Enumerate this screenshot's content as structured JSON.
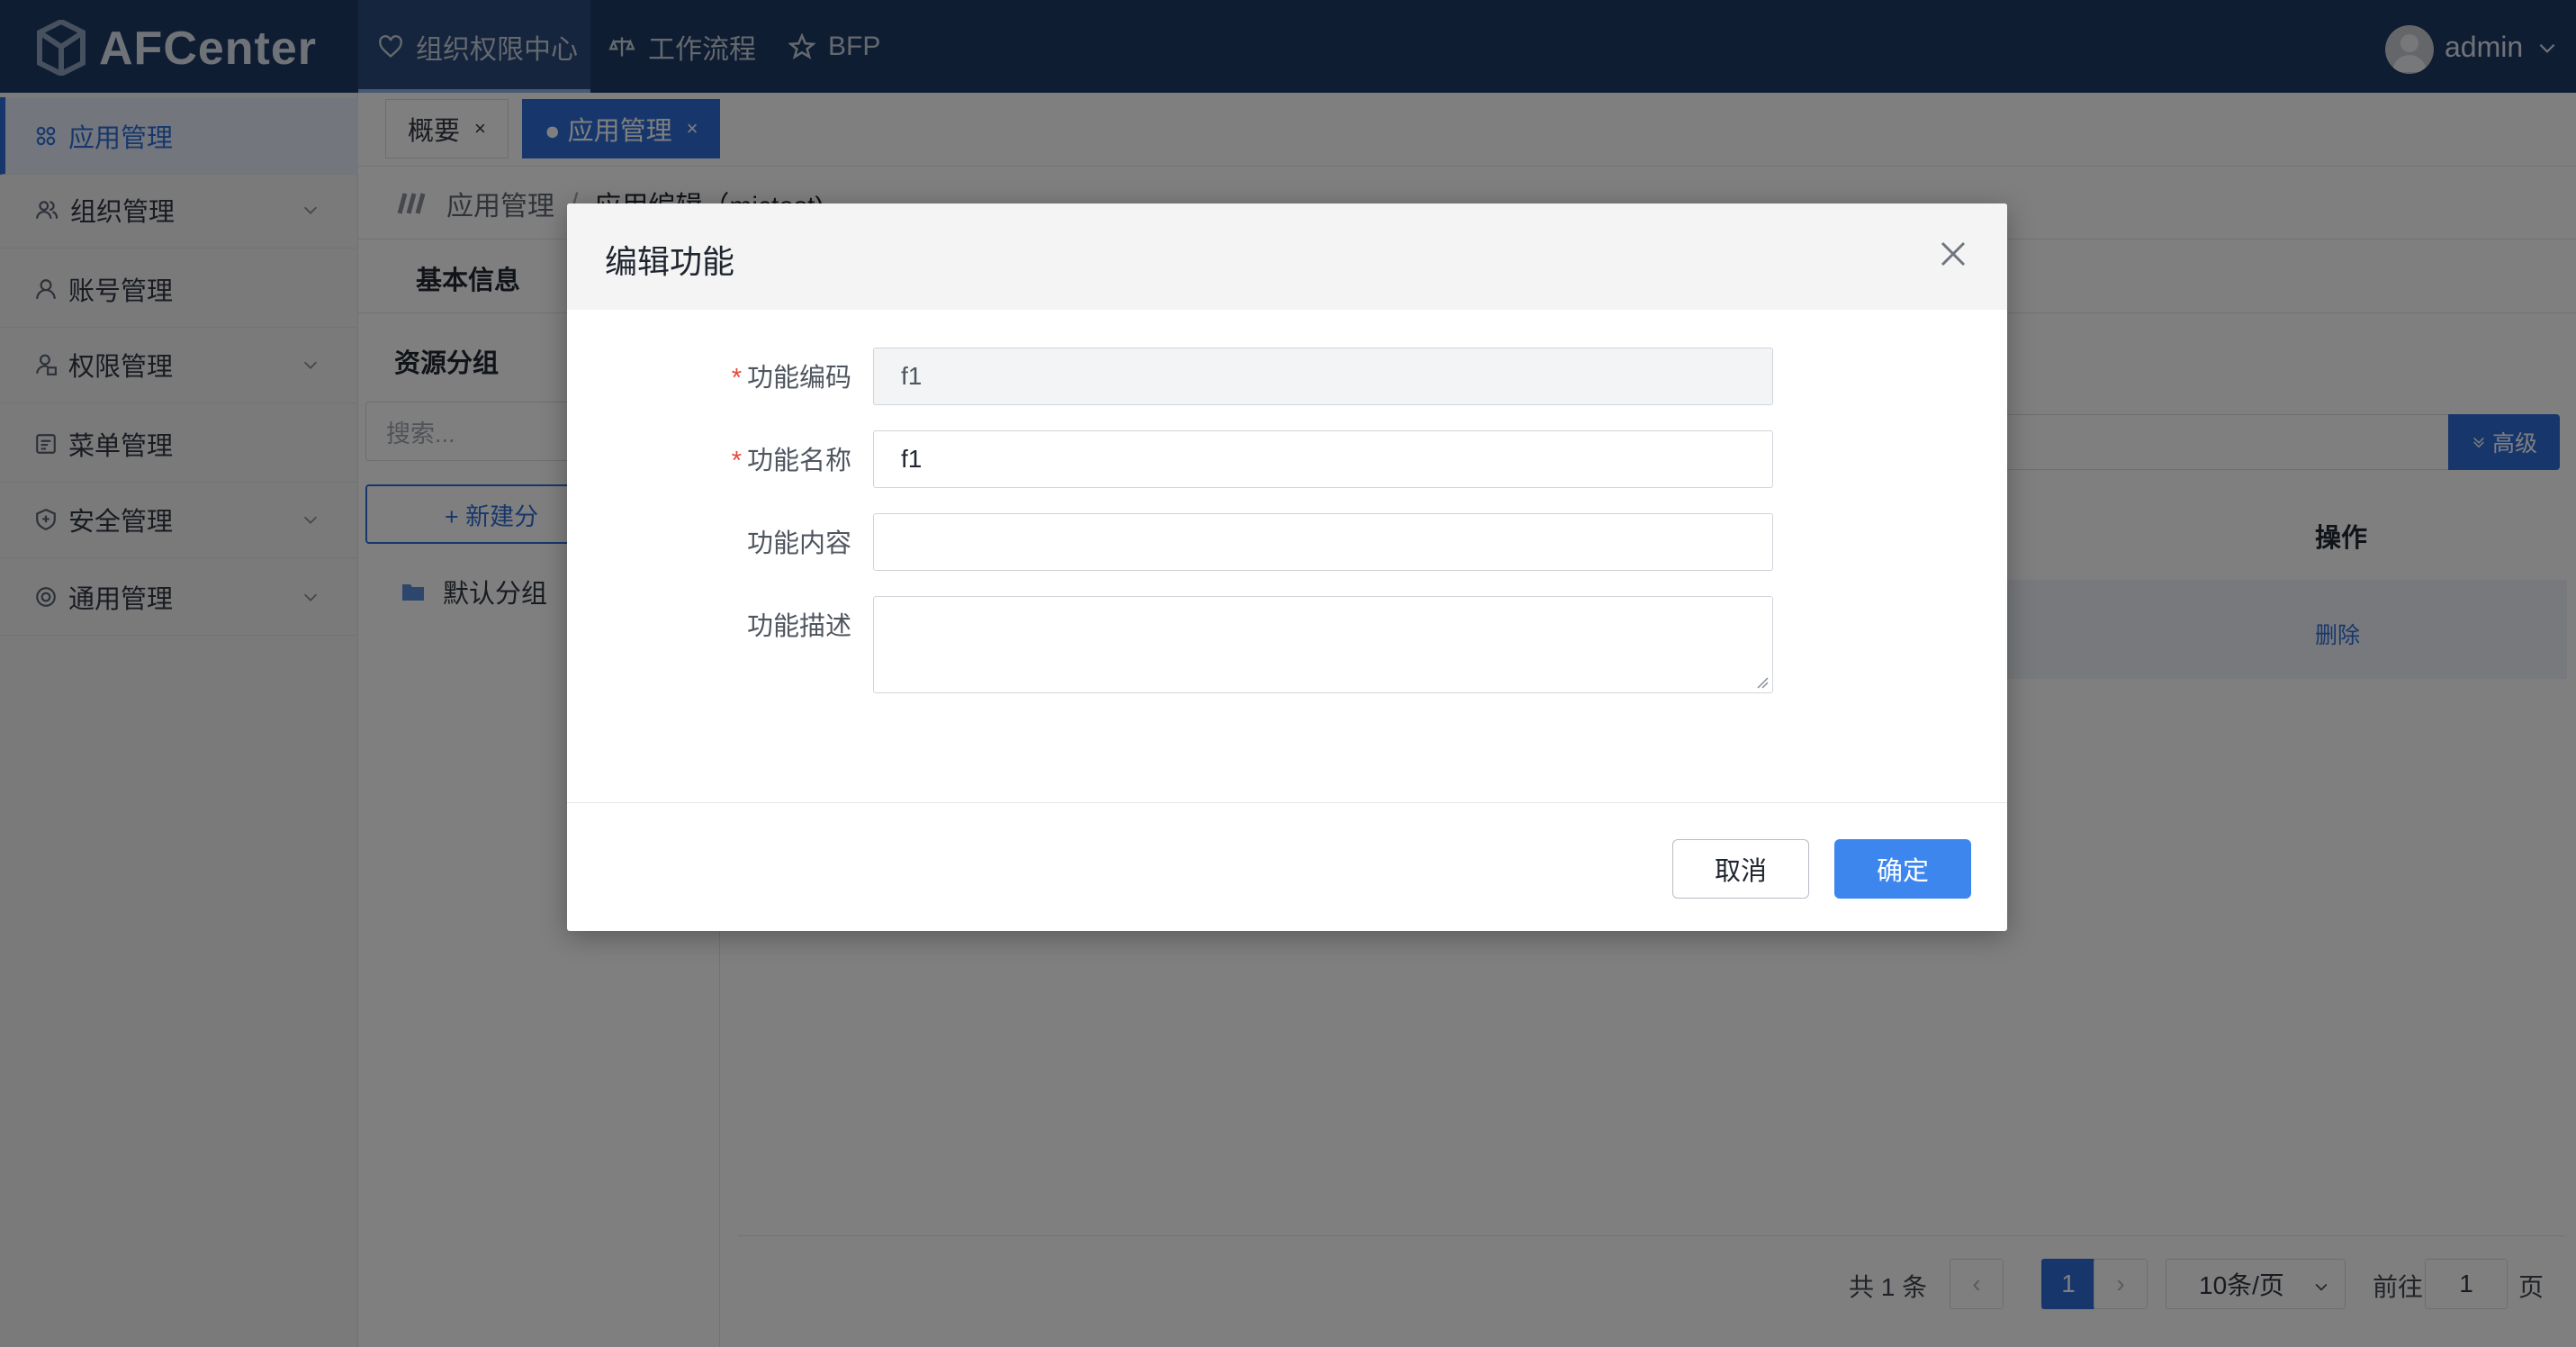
{
  "app": {
    "name": "AFCenter",
    "user": "admin"
  },
  "topnav": [
    {
      "label": "组织权限中心",
      "icon": "heart-icon",
      "active": true
    },
    {
      "label": "工作流程",
      "icon": "scale-icon",
      "active": false
    },
    {
      "label": "BFP",
      "icon": "star-icon",
      "active": false
    }
  ],
  "sidebar": {
    "items": [
      {
        "label": "应用管理",
        "icon": "grid-icon",
        "active": true
      },
      {
        "label": "组织管理",
        "icon": "users-icon",
        "expandable": true
      },
      {
        "label": "账号管理",
        "icon": "user-icon"
      },
      {
        "label": "权限管理",
        "icon": "lock-user-icon",
        "expandable": true
      },
      {
        "label": "菜单管理",
        "icon": "menu-icon"
      },
      {
        "label": "安全管理",
        "icon": "shield-icon",
        "expandable": true
      },
      {
        "label": "通用管理",
        "icon": "settings-icon",
        "expandable": true
      }
    ]
  },
  "tabs": [
    {
      "label": "概要",
      "close": "×",
      "active": false
    },
    {
      "label": "● 应用管理",
      "close": "×",
      "active": true
    }
  ],
  "breadcrumb": {
    "root": "应用管理",
    "sep": "/",
    "current": "应用编辑（mictest)"
  },
  "subtabs": {
    "first": "基本信息"
  },
  "left_panel": {
    "title": "资源分组",
    "search_placeholder": "搜索...",
    "new_button": "+ 新建分",
    "folder": "默认分组"
  },
  "table": {
    "op_header": "操作",
    "row_action": "删除",
    "advanced": "高级"
  },
  "pagination": {
    "total": "共 1 条",
    "prev": "‹",
    "current": "1",
    "next": "›",
    "page_size": "10条/页",
    "goto_label": "前往",
    "goto_value": "1",
    "page_suffix": "页"
  },
  "modal": {
    "title": "编辑功能",
    "fields": [
      {
        "label": "功能编码",
        "required": true,
        "value": "f1",
        "disabled": true
      },
      {
        "label": "功能名称",
        "required": true,
        "value": "f1"
      },
      {
        "label": "功能内容",
        "required": false,
        "value": ""
      },
      {
        "label": "功能描述",
        "required": false,
        "value": ""
      }
    ],
    "required_mark": "*",
    "cancel": "取消",
    "ok": "确定"
  }
}
